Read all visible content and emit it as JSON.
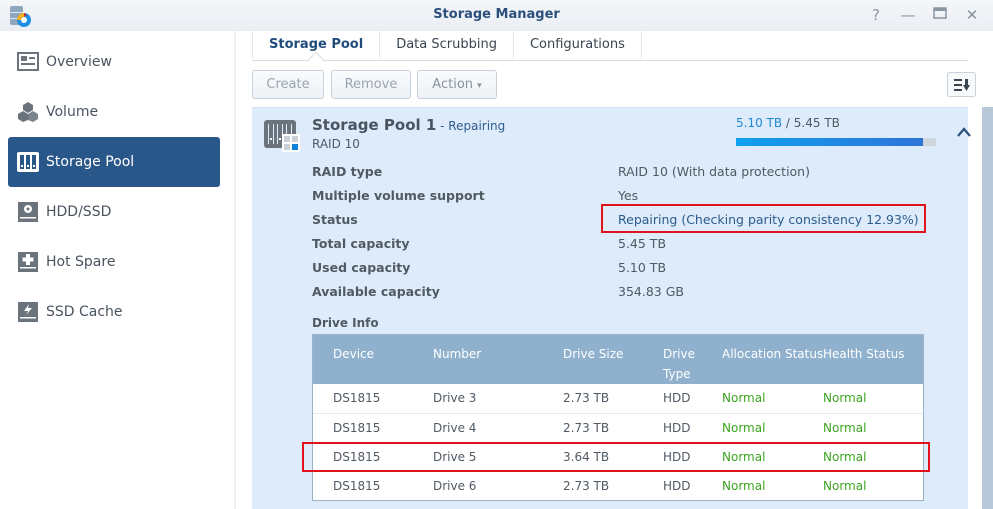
{
  "window": {
    "title": "Storage Manager",
    "controls": [
      "help-icon",
      "minimize-icon",
      "maximize-icon",
      "close-icon"
    ]
  },
  "sidebar": {
    "items": [
      {
        "label": "Overview",
        "icon": "overview-icon",
        "active": false
      },
      {
        "label": "Volume",
        "icon": "volume-cubes-icon",
        "active": false
      },
      {
        "label": "Storage Pool",
        "icon": "storage-pool-icon",
        "active": true
      },
      {
        "label": "HDD/SSD",
        "icon": "hdd-icon",
        "active": false
      },
      {
        "label": "Hot Spare",
        "icon": "hot-spare-icon",
        "active": false
      },
      {
        "label": "SSD Cache",
        "icon": "ssd-cache-icon",
        "active": false
      }
    ]
  },
  "tabs": [
    {
      "label": "Storage Pool",
      "active": true
    },
    {
      "label": "Data Scrubbing",
      "active": false
    },
    {
      "label": "Configurations",
      "active": false
    }
  ],
  "toolbar": {
    "create_label": "Create",
    "remove_label": "Remove",
    "action_label": "Action",
    "action_caret": "▾"
  },
  "pool": {
    "name": "Storage Pool 1",
    "state": " - Repairing",
    "raid": "RAID 10",
    "usage_used": "5.10 TB",
    "usage_sep": " / ",
    "usage_total": "5.45 TB",
    "usage_fraction": 0.936,
    "properties": [
      {
        "label": "RAID type",
        "value": "RAID 10 (With data protection)"
      },
      {
        "label": "Multiple volume support",
        "value": "Yes"
      },
      {
        "label": "Status",
        "value": "Repairing (Checking parity consistency 12.93%)"
      },
      {
        "label": "Total capacity",
        "value": "5.45 TB"
      },
      {
        "label": "Used capacity",
        "value": "5.10 TB"
      },
      {
        "label": "Available capacity",
        "value": "354.83 GB"
      }
    ],
    "drive_info_title": "Drive Info",
    "drive_columns": [
      "Device",
      "Number",
      "Drive Size",
      "Drive Type",
      "Allocation Status",
      "Health Status"
    ],
    "drive_column_lines": [
      [
        "Device"
      ],
      [
        "Number"
      ],
      [
        "Drive Size"
      ],
      [
        "Drive",
        "Type"
      ],
      [
        "Allocation Status"
      ],
      [
        "Health Status"
      ]
    ],
    "drives": [
      {
        "device": "DS1815",
        "number": "Drive 3",
        "size": "2.73 TB",
        "type": "HDD",
        "allocation": "Normal",
        "health": "Normal"
      },
      {
        "device": "DS1815",
        "number": "Drive 4",
        "size": "2.73 TB",
        "type": "HDD",
        "allocation": "Normal",
        "health": "Normal"
      },
      {
        "device": "DS1815",
        "number": "Drive 5",
        "size": "3.64 TB",
        "type": "HDD",
        "allocation": "Normal",
        "health": "Normal"
      },
      {
        "device": "DS1815",
        "number": "Drive 6",
        "size": "2.73 TB",
        "type": "HDD",
        "allocation": "Normal",
        "health": "Normal"
      }
    ]
  },
  "colors": {
    "accent": "#2a5789",
    "status_ok": "#3aa51f",
    "highlight": "#e0121c",
    "panel_bg": "#deebfa"
  }
}
